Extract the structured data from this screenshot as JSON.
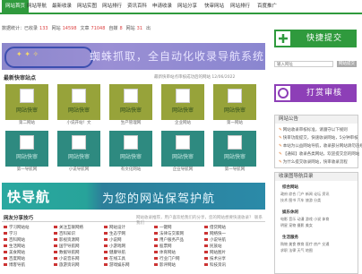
{
  "nav": {
    "items": [
      "网站首页",
      "网站导航",
      "最新收录",
      "网站实图",
      "网站排行",
      "资讯百科",
      "申请收录",
      "网站分享",
      "快审网站",
      "网站排行",
      "百度推广"
    ],
    "active_index": 0
  },
  "stats": {
    "prefix": "数据统计：",
    "parts": [
      {
        "label": "已收录",
        "value": "133"
      },
      {
        "label": "网站",
        "value": "14598"
      },
      {
        "label": "文章",
        "value": "71048"
      },
      {
        "label": "自媒",
        "value": "8"
      },
      {
        "label": "网站",
        "value": "31"
      }
    ],
    "suffix": "出"
  },
  "banner1": {
    "text": "蜘蛛抓取，全自动化收录导航系统"
  },
  "latest": {
    "title": "最新快审站点",
    "note": "最新快审站点审核成功后的网站 12/06/2022"
  },
  "tiles": [
    {
      "cap": "网站快审",
      "label": "第二网站",
      "color": "olive"
    },
    {
      "cap": "网站快审",
      "label": "小说开站！文",
      "color": "olive"
    },
    {
      "cap": "网站快审",
      "label": "生产管理网",
      "color": "olive"
    },
    {
      "cap": "网站快审",
      "label": "企业网站",
      "color": "olive"
    },
    {
      "cap": "网站快审",
      "label": "第一网站",
      "color": "olive"
    },
    {
      "cap": "网站快审",
      "label": "第一导航网",
      "color": "teal"
    },
    {
      "cap": "网站快审",
      "label": "小说导航网",
      "color": "teal"
    },
    {
      "cap": "网站快审",
      "label": "有文化网站",
      "color": "teal"
    },
    {
      "cap": "网站快审",
      "label": "企业导航网",
      "color": "teal"
    },
    {
      "cap": "网站快审",
      "label": "第一导航网",
      "color": "teal"
    }
  ],
  "banner2": {
    "left": "快导航",
    "right": "为您的网站保驾护航"
  },
  "friends": {
    "title": "网友分享技巧",
    "meta": "网站收录推荐，用户喜欢给我们的分享，您的网站想要快速收录？ 联系我们",
    "links": [
      [
        "学习网站站",
        "关注互联网络",
        "网站设计",
        "一键网",
        "借贷网站",
        "导航网"
      ],
      [
        "学习",
        "百科知识",
        "生态学网",
        "法律与交家网",
        "网络快一",
        "推广网站"
      ],
      [
        "百科网站",
        "影视资源网",
        "小说网",
        "用户服务产品",
        "小说导航",
        "影视导航"
      ],
      [
        "生活网站",
        "国学导航网",
        "小游戏网",
        "股票网",
        "民族站",
        "网站导航"
      ],
      [
        "美食网站",
        "数据导航网",
        "健康导航",
        "体育网站",
        "网站图片",
        "软件下载"
      ],
      [
        "百度网站",
        "小说音乐网",
        "在线工具",
        "行业门户网",
        "技术分享",
        "工具导航"
      ],
      [
        "博客导航",
        "旅游资讯网",
        "游戏娱乐网",
        "影评网站",
        "科技资讯",
        "活动导航"
      ]
    ]
  },
  "right": {
    "submit_label": "快捷提交",
    "submit_icon": "plus-icon",
    "review_label": "打赏审核",
    "review_icon": "hand-icon",
    "login": {
      "user_placeholder": "输入网址",
      "pass_placeholder": "",
      "btn": "网站提交"
    },
    "notice": {
      "title": "网站公告",
      "lines": [
        "网站收录审核标准，请遵守以下规则",
        "快审功能提交，快速收录网站，5分钟审核",
        "本站为公益网站导航，收录部分网站请勿违规",
        "【通知】收录各类网站，欢迎提交您的网站",
        "为什么提交收录网站，快审收录流程"
      ]
    },
    "guide": {
      "title": "收录图导航目录",
      "groups": [
        {
          "name": "综合网站",
          "rows": [
            "政府 综合 门户 新闻 论坛 资讯",
            "技术 图书 汽车 旅游 分类"
          ]
        },
        {
          "name": "娱乐休闲",
          "rows": [
            "电影 音乐 动漫 游戏 小说 体育",
            "明星 宠物 摄影 美女"
          ]
        },
        {
          "name": "生活服务",
          "rows": [
            "购物 美食 教育 医疗 房产 交通",
            "求职 法律 天气 地图"
          ]
        }
      ]
    }
  }
}
